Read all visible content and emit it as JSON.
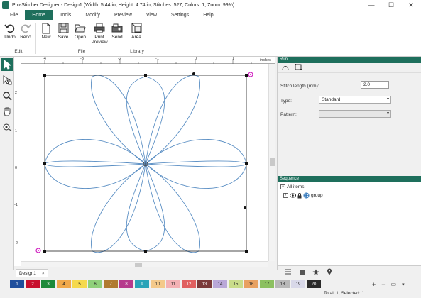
{
  "window": {
    "title": "Pro-Stitcher Designer - Design1 (Width: 5.44 in, Height: 4.74 in, Stitches: 527, Colors: 1, Zoom: 99%)",
    "controls": [
      "—",
      "☐",
      "✕"
    ]
  },
  "ribbon": {
    "tabs": [
      "File",
      "Home",
      "Tools",
      "Modify",
      "Preview",
      "View",
      "Settings",
      "Help"
    ],
    "active_tab": "Home",
    "buttons": {
      "undo": "Undo",
      "redo": "Redo",
      "new": "New",
      "save": "Save",
      "open": "Open",
      "print_preview": "Print Preview",
      "send": "Send",
      "area": "Area"
    },
    "groups": {
      "edit": "Edit",
      "file": "File",
      "library": "Library"
    }
  },
  "ruler": {
    "unit": "inches",
    "top_labels": [
      "-4",
      "-3",
      "-2",
      "-1",
      "0",
      "1"
    ],
    "left_labels": [
      "2",
      "1",
      "0",
      "-1",
      "-2"
    ]
  },
  "document": {
    "tab_label": "Design1",
    "tab_close": "×"
  },
  "run_panel": {
    "header": "Run",
    "stitch_length_label": "Stitch length (mm):",
    "stitch_length_value": "2.0",
    "type_label": "Type:",
    "type_value": "Standard",
    "pattern_label": "Pattern:",
    "pattern_value": ""
  },
  "sequence_panel": {
    "header": "Sequence",
    "items": [
      {
        "label": "All items"
      },
      {
        "label": "group"
      }
    ]
  },
  "colors": {
    "accent": "#1e6f5c",
    "stitch": "#5b8fc4",
    "selection_handle": "#111111",
    "marker": "#d020c0",
    "swatches": [
      {
        "n": "1",
        "c": "#1f4e9c"
      },
      {
        "n": "2",
        "c": "#c8102e"
      },
      {
        "n": "3",
        "c": "#1d8a3a"
      },
      {
        "n": "4",
        "c": "#f0a84a"
      },
      {
        "n": "5",
        "c": "#f5d94e"
      },
      {
        "n": "6",
        "c": "#8fd07a"
      },
      {
        "n": "7",
        "c": "#b07a30"
      },
      {
        "n": "8",
        "c": "#b63a8c"
      },
      {
        "n": "9",
        "c": "#2aa3b8"
      },
      {
        "n": "10",
        "c": "#f4c98a"
      },
      {
        "n": "11",
        "c": "#f4b0b4"
      },
      {
        "n": "12",
        "c": "#e06060"
      },
      {
        "n": "13",
        "c": "#7a3a3a"
      },
      {
        "n": "14",
        "c": "#b9a8d8"
      },
      {
        "n": "15",
        "c": "#c9dc8a"
      },
      {
        "n": "16",
        "c": "#e8a060"
      },
      {
        "n": "17",
        "c": "#8cc060"
      },
      {
        "n": "18",
        "c": "#b8b8b8"
      },
      {
        "n": "19",
        "c": "#d8d8e8"
      },
      {
        "n": "20",
        "c": "#2a2a2a"
      }
    ]
  },
  "status": {
    "text": "Total: 1, Selected: 1"
  }
}
